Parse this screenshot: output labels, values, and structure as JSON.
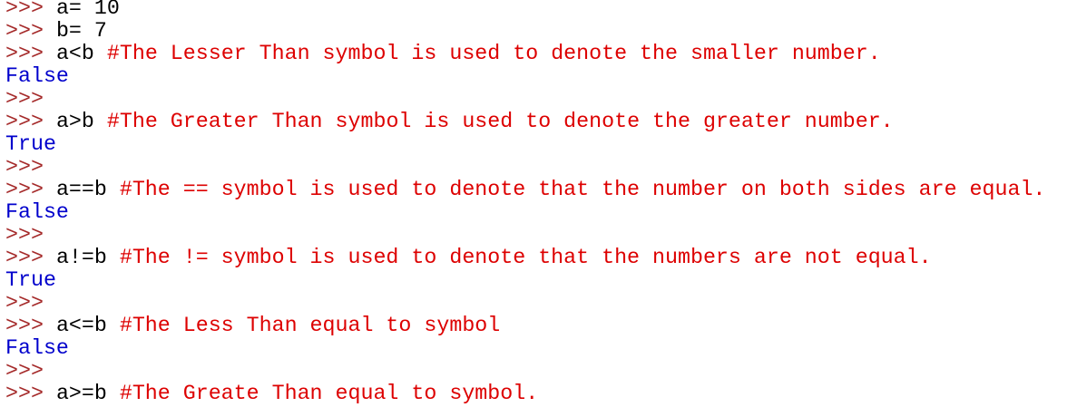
{
  "colors": {
    "background": "#ffffff",
    "prompt": "#a52a2a",
    "code": "#000000",
    "comment": "#dd0000",
    "output": "#0000cc"
  },
  "shell": {
    "prompt": ">>>",
    "lines": [
      {
        "type": "input",
        "code": "a= 10",
        "comment": ""
      },
      {
        "type": "input",
        "code": "b= 7",
        "comment": ""
      },
      {
        "type": "input",
        "code": "a<b",
        "comment": "#The Lesser Than symbol is used to denote the smaller number."
      },
      {
        "type": "output",
        "text": "False"
      },
      {
        "type": "input",
        "code": "",
        "comment": ""
      },
      {
        "type": "input",
        "code": "a>b",
        "comment": "#The Greater Than symbol is used to denote the greater number."
      },
      {
        "type": "output",
        "text": "True"
      },
      {
        "type": "input",
        "code": "",
        "comment": ""
      },
      {
        "type": "input",
        "code": "a==b",
        "comment": "#The == symbol is used to denote that the number on both sides are equal."
      },
      {
        "type": "output",
        "text": "False"
      },
      {
        "type": "input",
        "code": "",
        "comment": ""
      },
      {
        "type": "input",
        "code": "a!=b",
        "comment": "#The != symbol is used to denote that the numbers are not equal."
      },
      {
        "type": "output",
        "text": "True"
      },
      {
        "type": "input",
        "code": "",
        "comment": ""
      },
      {
        "type": "input",
        "code": "a<=b",
        "comment": "#The Less Than equal to symbol"
      },
      {
        "type": "output",
        "text": "False"
      },
      {
        "type": "input",
        "code": "",
        "comment": ""
      },
      {
        "type": "input",
        "code": "a>=b",
        "comment": "#The Greate Than equal to symbol."
      }
    ]
  }
}
